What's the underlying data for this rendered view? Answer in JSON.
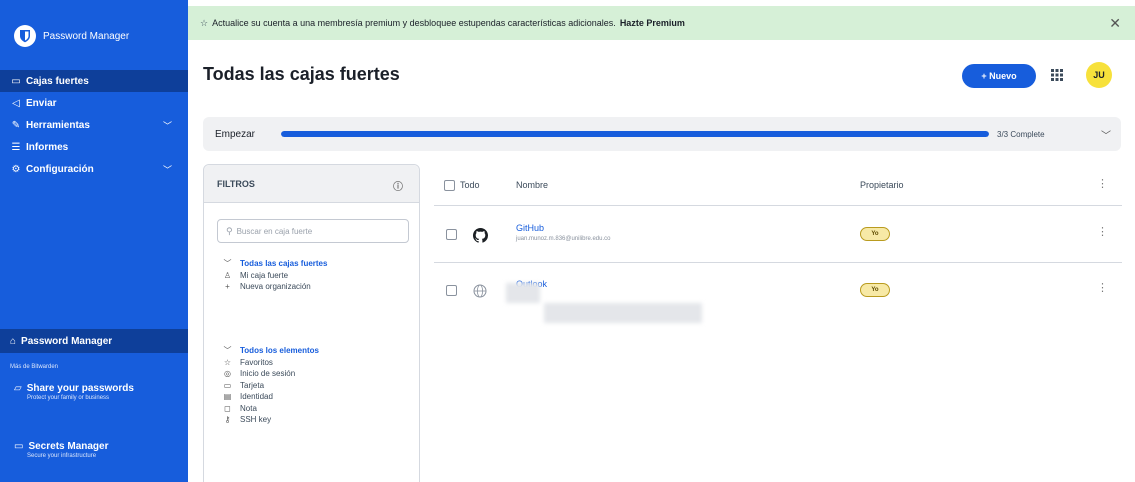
{
  "app": {
    "name": "Password Manager"
  },
  "sidebar": {
    "items": [
      {
        "label": "Cajas fuertes",
        "icon": "vault-icon",
        "active": true
      },
      {
        "label": "Enviar",
        "icon": "send-icon"
      },
      {
        "label": "Herramientas",
        "icon": "tools-icon",
        "expandable": true
      },
      {
        "label": "Informes",
        "icon": "reports-icon"
      },
      {
        "label": "Configuración",
        "icon": "settings-icon",
        "expandable": true
      }
    ],
    "product_switcher": {
      "label": "Password Manager"
    },
    "more_from": "Más de Bitwarden",
    "products": [
      {
        "title": "Share your passwords",
        "subtitle": "Protect your family or business"
      },
      {
        "title": "Secrets Manager",
        "subtitle": "Secure your infrastructure"
      }
    ]
  },
  "banner": {
    "text": "Actualice su cuenta a una membresía premium y desbloquee estupendas características adicionales.",
    "link": "Hazte Premium",
    "close": "✕"
  },
  "header": {
    "title": "Todas las cajas fuertes",
    "new_button": "+ Nuevo",
    "avatar_initials": "JU"
  },
  "progress": {
    "label": "Empezar",
    "status": "3/3 Complete",
    "completed": 3,
    "total": 3
  },
  "filters": {
    "title": "FILTROS",
    "search_placeholder": "Buscar en caja fuerte",
    "vaults_group": {
      "label": "Todas las cajas fuertes",
      "items": [
        "Mi caja fuerte",
        "Nueva organización"
      ]
    },
    "items_group": {
      "label": "Todos los elementos",
      "items": [
        "Favoritos",
        "Inicio de sesión",
        "Tarjeta",
        "Identidad",
        "Nota",
        "SSH key"
      ]
    }
  },
  "table": {
    "columns": {
      "all": "Todo",
      "name": "Nombre",
      "owner": "Propietario"
    },
    "rows": [
      {
        "name": "GitHub",
        "subtitle": "juan.munoz.m.836@unilibre.edu.co",
        "owner_badge": "Yo"
      },
      {
        "name": "Outlook",
        "subtitle": "",
        "owner_badge": "Yo"
      }
    ]
  },
  "colors": {
    "brand": "#175ddc",
    "sidebar_active": "#0e3f9a",
    "banner_bg": "#d6f0d7",
    "avatar_bg": "#f7e13b",
    "badge_bg": "#f7e9a6"
  }
}
